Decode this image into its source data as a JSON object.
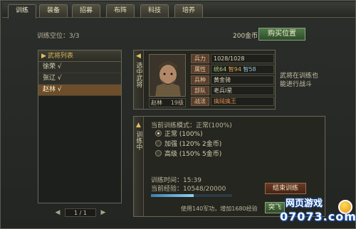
{
  "tabs": [
    "训练",
    "装备",
    "招募",
    "布阵",
    "科技",
    "培养"
  ],
  "header": {
    "slots_label": "训练空位：3/3",
    "gold": "200金币",
    "buy_button": "购买位置"
  },
  "general_list": {
    "title": "武将列表",
    "items": [
      "徐荣 √",
      "张辽 √",
      "赵林 √"
    ],
    "selected_index": 2,
    "page": "1 / 1"
  },
  "selected_general": {
    "tab_label": "选中武将",
    "name": "赵林",
    "level": "19级",
    "attributes": [
      {
        "key": "兵力",
        "value": "1028/1028"
      },
      {
        "key": "属性",
        "str": "统64",
        "int": "智94",
        "pol": "智58"
      },
      {
        "key": "兵种",
        "value": "黄金骑"
      },
      {
        "key": "部队",
        "value": "老兵Ⅰ星"
      },
      {
        "key": "战法",
        "value": "擒贼擒王"
      }
    ],
    "status_note": "武将在训练也能进行战斗"
  },
  "training": {
    "tab_label": "训练中",
    "mode_title": "当前训练模式：正常(100%)",
    "options": [
      {
        "label": "正常 (100%)",
        "selected": true
      },
      {
        "label": "加强 (120% 2金币)",
        "selected": false
      },
      {
        "label": "高级 (150% 5金币)",
        "selected": false
      }
    ],
    "time": "训练时间：15:39",
    "exp": "当前经验：10548/20000",
    "exp_progress": 0.53,
    "end_button": "结束训练",
    "speed_button": "突飞",
    "cost_note": "使用140军功，增加1680经验"
  },
  "watermark": {
    "line1": "网页游戏",
    "line2": "07073.com"
  }
}
